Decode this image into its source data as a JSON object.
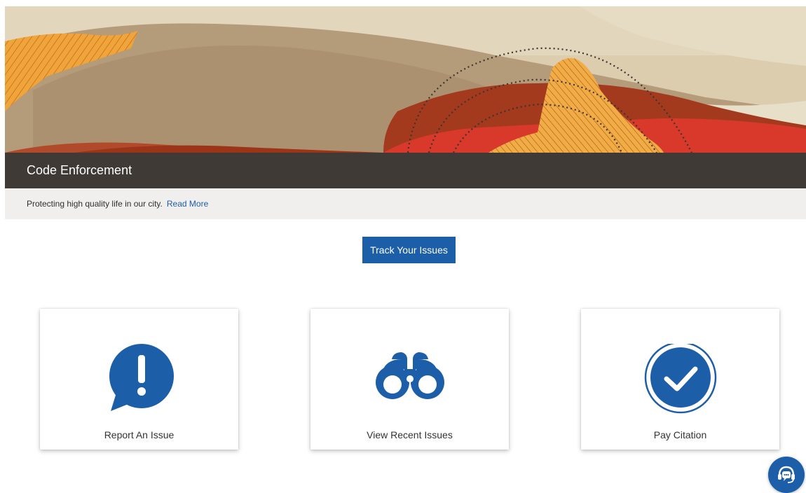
{
  "header": {
    "title": "Code Enforcement",
    "description": "Protecting high quality life in our city.",
    "read_more": "Read More"
  },
  "actions": {
    "track_label": "Track Your Issues"
  },
  "cards": [
    {
      "label": "Report An Issue",
      "icon": "speech-bubble-exclamation-icon"
    },
    {
      "label": "View Recent Issues",
      "icon": "binoculars-icon"
    },
    {
      "label": "Pay Citation",
      "icon": "checkmark-circle-icon"
    }
  ],
  "help": {
    "icon": "headset-chat-icon"
  },
  "colors": {
    "accent": "#1c5fa8",
    "title_bar": "#3f3a36",
    "desc_bar": "#f0efee",
    "banner_sand": "#c9b496",
    "banner_rust": "#a33a1e",
    "banner_red": "#d8392b",
    "banner_orange": "#f0a43a"
  }
}
